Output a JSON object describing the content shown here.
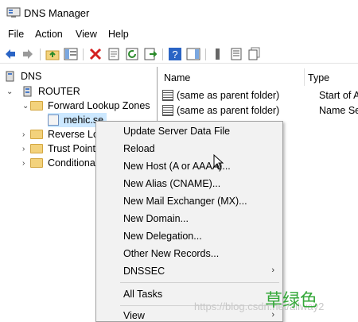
{
  "window": {
    "title": "DNS Manager",
    "icon": "dns-manager-icon"
  },
  "menu": [
    "File",
    "Action",
    "View",
    "Help"
  ],
  "toolbar": [
    "back-icon",
    "forward-icon",
    "up-folder-icon",
    "show-hide-tree-icon",
    "delete-icon",
    "properties-icon",
    "refresh-icon",
    "export-list-icon",
    "help-icon",
    "show-action-pane-icon",
    "zone-list-icon",
    "record-icon",
    "copy-icon"
  ],
  "tree": {
    "root": "DNS",
    "server": "ROUTER",
    "forward": "Forward Lookup Zones",
    "zone": "mehic.se",
    "reverse": "Reverse Lo",
    "trust": "Trust Point",
    "conditional": "Conditiona"
  },
  "list": {
    "columns": [
      "Name",
      "Type"
    ],
    "rows": [
      {
        "name": "(same as parent folder)",
        "type": "Start of Auth"
      },
      {
        "name": "(same as parent folder)",
        "type": "Name Serve"
      }
    ]
  },
  "context_menu": {
    "items": [
      "Update Server Data File",
      "Reload",
      "New Host (A or AAAA)...",
      "New Alias (CNAME)...",
      "New Mail Exchanger (MX)...",
      "New Domain...",
      "New Delegation...",
      "Other New Records...",
      "DNSSEC",
      "All Tasks",
      "View"
    ],
    "submenu_arrow": "›"
  },
  "watermark": {
    "label": "草绿色",
    "url": "https://blog.csdn.net/allway2",
    "color": "#35a83a"
  }
}
